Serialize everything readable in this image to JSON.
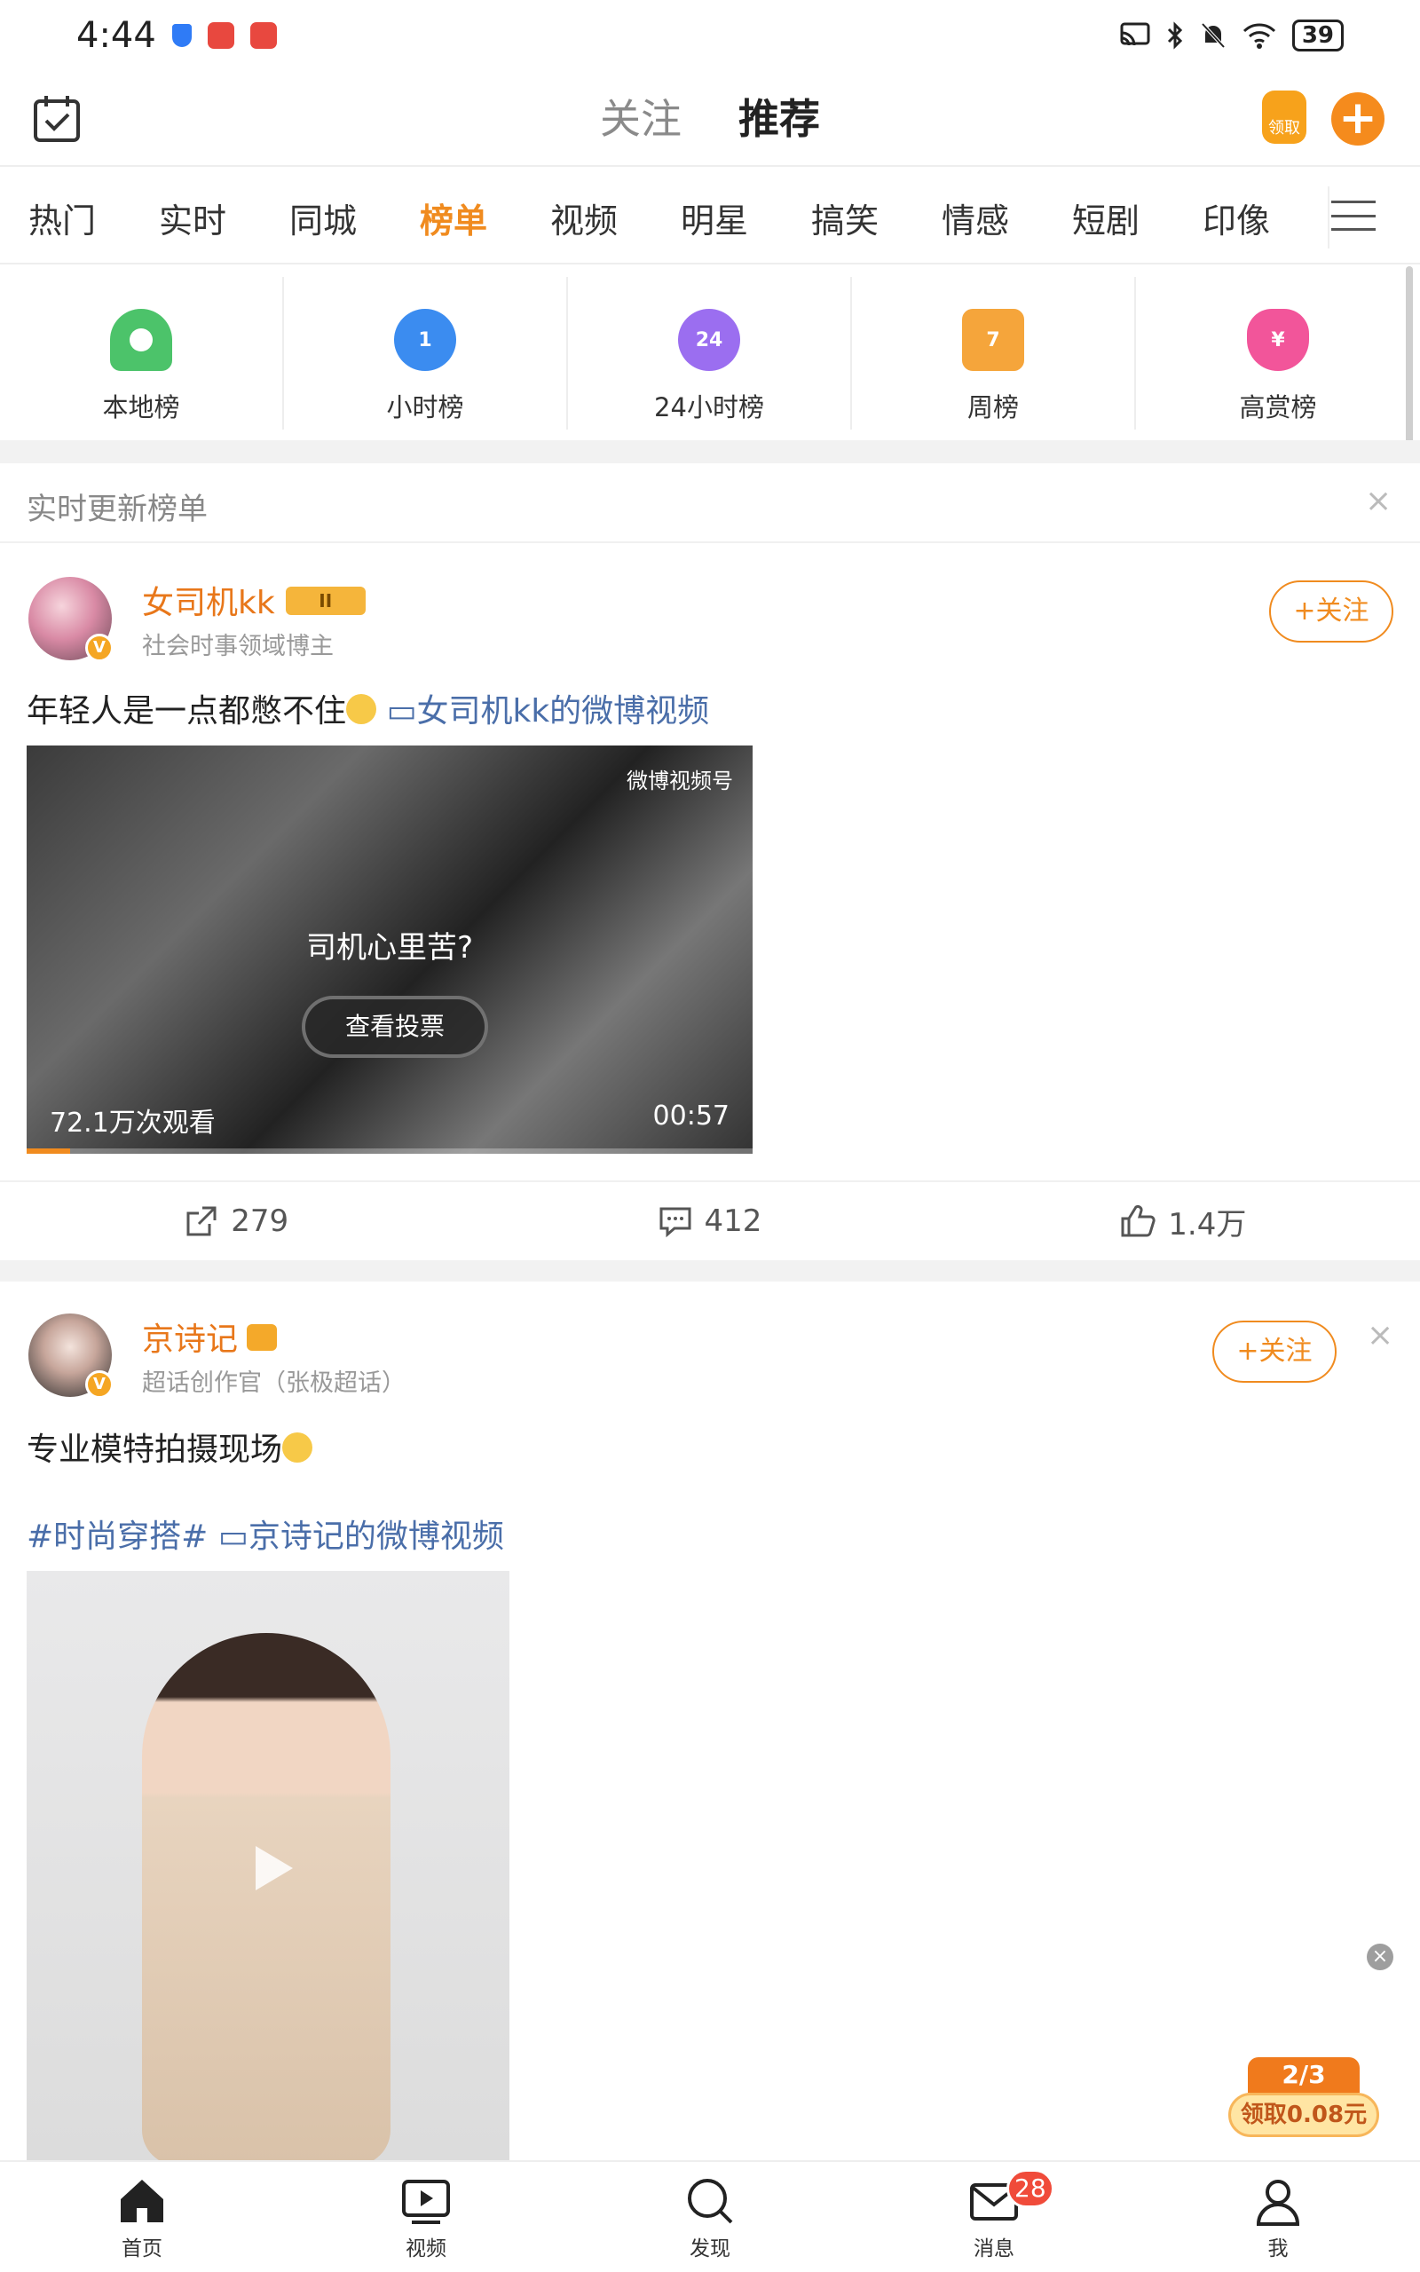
{
  "status_bar": {
    "time": "4:44",
    "battery": "39"
  },
  "top_bar": {
    "tabs": [
      {
        "label": "关注",
        "active": false
      },
      {
        "label": "推荐",
        "active": true
      }
    ],
    "reward_label": "领取",
    "add_label": "+"
  },
  "categories": [
    "热门",
    "实时",
    "同城",
    "榜单",
    "视频",
    "明星",
    "搞笑",
    "情感",
    "短剧",
    "印像"
  ],
  "active_category": "榜单",
  "rank_shortcuts": [
    {
      "label": "本地榜",
      "icon": "location-pin-icon",
      "color": "#4cc36a",
      "glyph": ""
    },
    {
      "label": "小时榜",
      "icon": "hour-clock-icon",
      "color": "#3b8cf0",
      "glyph": "1"
    },
    {
      "label": "24小时榜",
      "icon": "24h-clock-icon",
      "color": "#9b6ef0",
      "glyph": "24"
    },
    {
      "label": "周榜",
      "icon": "calendar-week-icon",
      "color": "#f5a53b",
      "glyph": "7"
    },
    {
      "label": "高赏榜",
      "icon": "heart-money-icon",
      "color": "#f2559a",
      "glyph": "¥"
    }
  ],
  "section": {
    "title": "实时更新榜单",
    "close": "×"
  },
  "post1": {
    "author": "女司机kk",
    "badge": "II",
    "subtitle": "社会时事领域博主",
    "follow": "+关注",
    "text": "年轻人是一点都憋不住",
    "link": "女司机kk的微博视频",
    "video": {
      "question": "司机心里苦?",
      "vote": "查看投票",
      "views": "72.1万次观看",
      "duration": "00:57",
      "watermark": "微博视频号",
      "progress": 0.06
    },
    "actions": {
      "share": "279",
      "comment": "412",
      "like": "1.4万"
    }
  },
  "post2": {
    "author": "京诗记",
    "subtitle": "超话创作官（张极超话）",
    "follow": "+关注",
    "close": "×",
    "text": "专业模特拍摄现场",
    "hashtag": "#时尚穿搭#",
    "link": "京诗记的微博视频"
  },
  "task_widget": {
    "progress": "2/3",
    "reward": "领取0.08元"
  },
  "float_close": "×",
  "bottom_nav": [
    {
      "label": "首页",
      "icon": "home-icon"
    },
    {
      "label": "视频",
      "icon": "video-icon"
    },
    {
      "label": "发现",
      "icon": "search-icon"
    },
    {
      "label": "消息",
      "icon": "mail-icon",
      "badge": "28"
    },
    {
      "label": "我",
      "icon": "profile-icon"
    }
  ]
}
